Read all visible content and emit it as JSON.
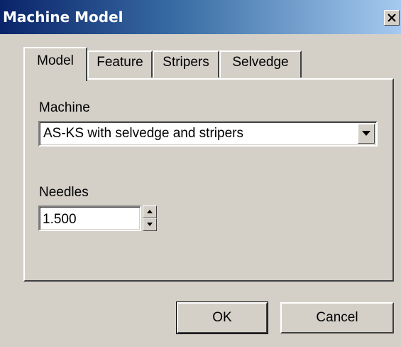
{
  "window": {
    "title": "Machine Model",
    "close_label": "×"
  },
  "tabs": [
    {
      "label": "Model",
      "active": true
    },
    {
      "label": "Feature",
      "active": false
    },
    {
      "label": "Stripers",
      "active": false
    },
    {
      "label": "Selvedge",
      "active": false
    }
  ],
  "model": {
    "machine_label": "Machine",
    "machine_value": "AS-KS with selvedge and stripers",
    "needles_label": "Needles",
    "needles_value": "1.500"
  },
  "buttons": {
    "ok_label": "OK",
    "cancel_label": "Cancel"
  },
  "icons": {
    "close": "close-icon",
    "dropdown": "chevron-down-icon",
    "spin_up": "arrow-up-icon",
    "spin_down": "arrow-down-icon"
  },
  "colors": {
    "titlebar_start": "#0a246a",
    "titlebar_end": "#a6caf0",
    "face": "#d4d0c8"
  }
}
